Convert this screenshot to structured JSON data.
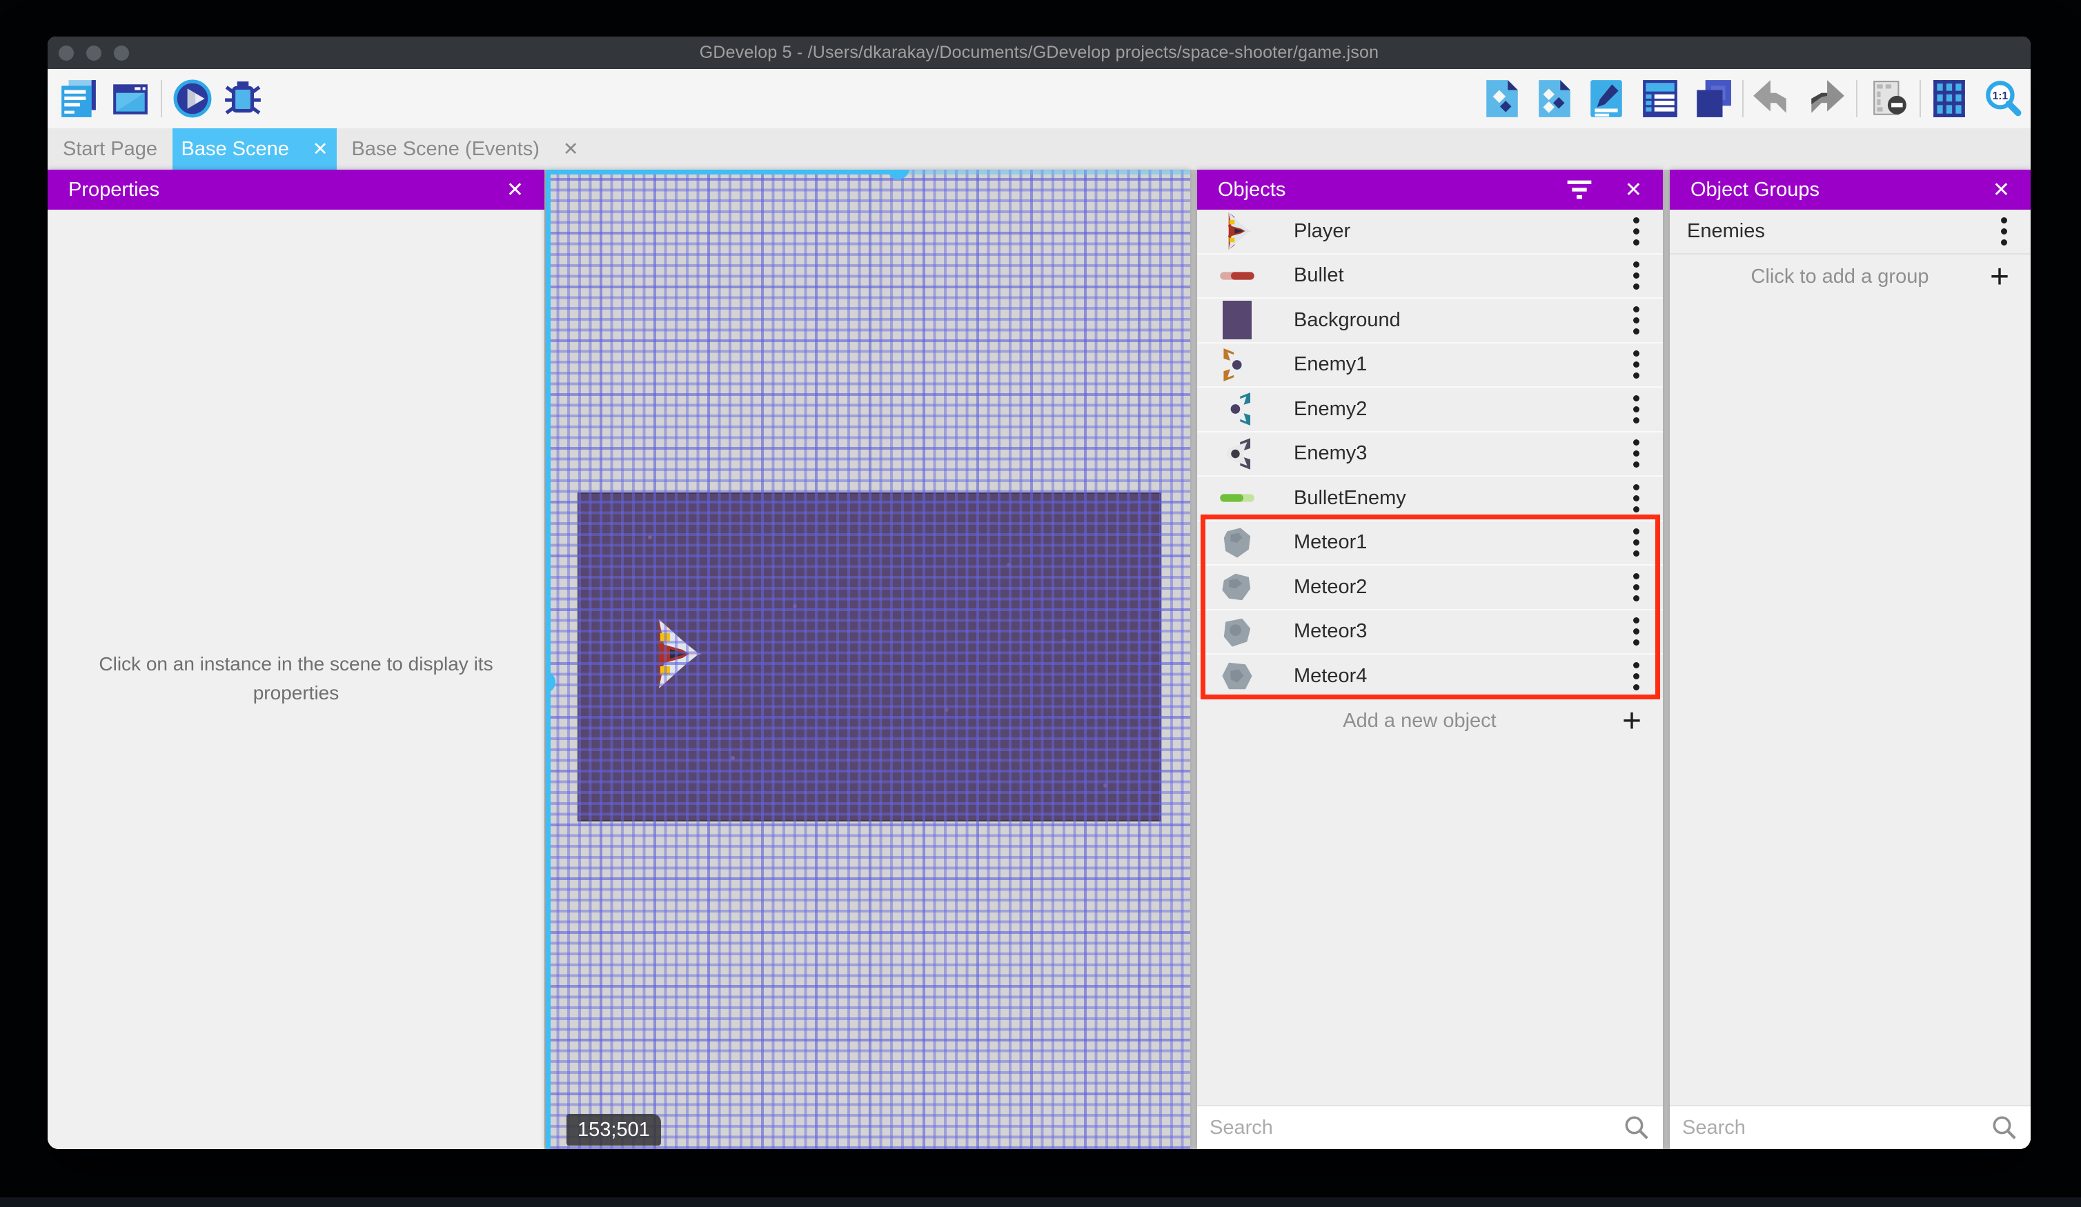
{
  "window": {
    "title": "GDevelop 5 - /Users/dkarakay/Documents/GDevelop projects/space-shooter/game.json"
  },
  "glyphs": {
    "close": "✕",
    "add": "+"
  },
  "toolbar": {
    "zoom_label": "1:1",
    "left_icons": [
      "project-manager-icon",
      "scene-editor-icon",
      "play-preview-icon",
      "debug-icon"
    ],
    "right_icons": [
      "open-objects-panel-icon",
      "open-object-groups-panel-icon",
      "open-properties-panel-icon",
      "open-instances-list-icon",
      "open-layers-panel-icon",
      "undo-icon",
      "redo-icon",
      "toggle-window-mask-icon",
      "toggle-grid-icon",
      "zoom-one-to-one-icon"
    ]
  },
  "tabs": {
    "items": [
      {
        "label": "Start Page",
        "active": false
      },
      {
        "label": "Base Scene",
        "active": true
      },
      {
        "label": "Base Scene (Events)",
        "active": false
      }
    ]
  },
  "properties_panel": {
    "title": "Properties",
    "empty_message": "Click on an instance in the scene to display its properties"
  },
  "scene": {
    "coordinate_indicator": "153;501",
    "selection_color": "#4FC3F7"
  },
  "objects_panel": {
    "title": "Objects",
    "items": [
      {
        "label": "Player",
        "icon": "player-ship-icon"
      },
      {
        "label": "Bullet",
        "icon": "bullet-icon"
      },
      {
        "label": "Background",
        "icon": "background-swatch-icon"
      },
      {
        "label": "Enemy1",
        "icon": "enemy1-ship-icon"
      },
      {
        "label": "Enemy2",
        "icon": "enemy2-ship-icon"
      },
      {
        "label": "Enemy3",
        "icon": "enemy3-ship-icon"
      },
      {
        "label": "BulletEnemy",
        "icon": "bullet-enemy-icon"
      },
      {
        "label": "Meteor1",
        "icon": "meteor-icon"
      },
      {
        "label": "Meteor2",
        "icon": "meteor-icon"
      },
      {
        "label": "Meteor3",
        "icon": "meteor-icon"
      },
      {
        "label": "Meteor4",
        "icon": "meteor-icon"
      }
    ],
    "highlight": {
      "rows": [
        "Meteor1",
        "Meteor2",
        "Meteor3",
        "Meteor4"
      ],
      "color": "#FF2D12"
    },
    "add_label": "Add a new object",
    "search_placeholder": "Search"
  },
  "object_groups_panel": {
    "title": "Object Groups",
    "items": [
      {
        "label": "Enemies"
      }
    ],
    "add_label": "Click to add a group",
    "search_placeholder": "Search"
  },
  "colors": {
    "header_purple": "#9B00C9",
    "active_tab_blue": "#4FC3F7",
    "highlight_red": "#FF2D12",
    "scene_background": "#D3D3D3",
    "game_background_rect": "#57466F"
  }
}
